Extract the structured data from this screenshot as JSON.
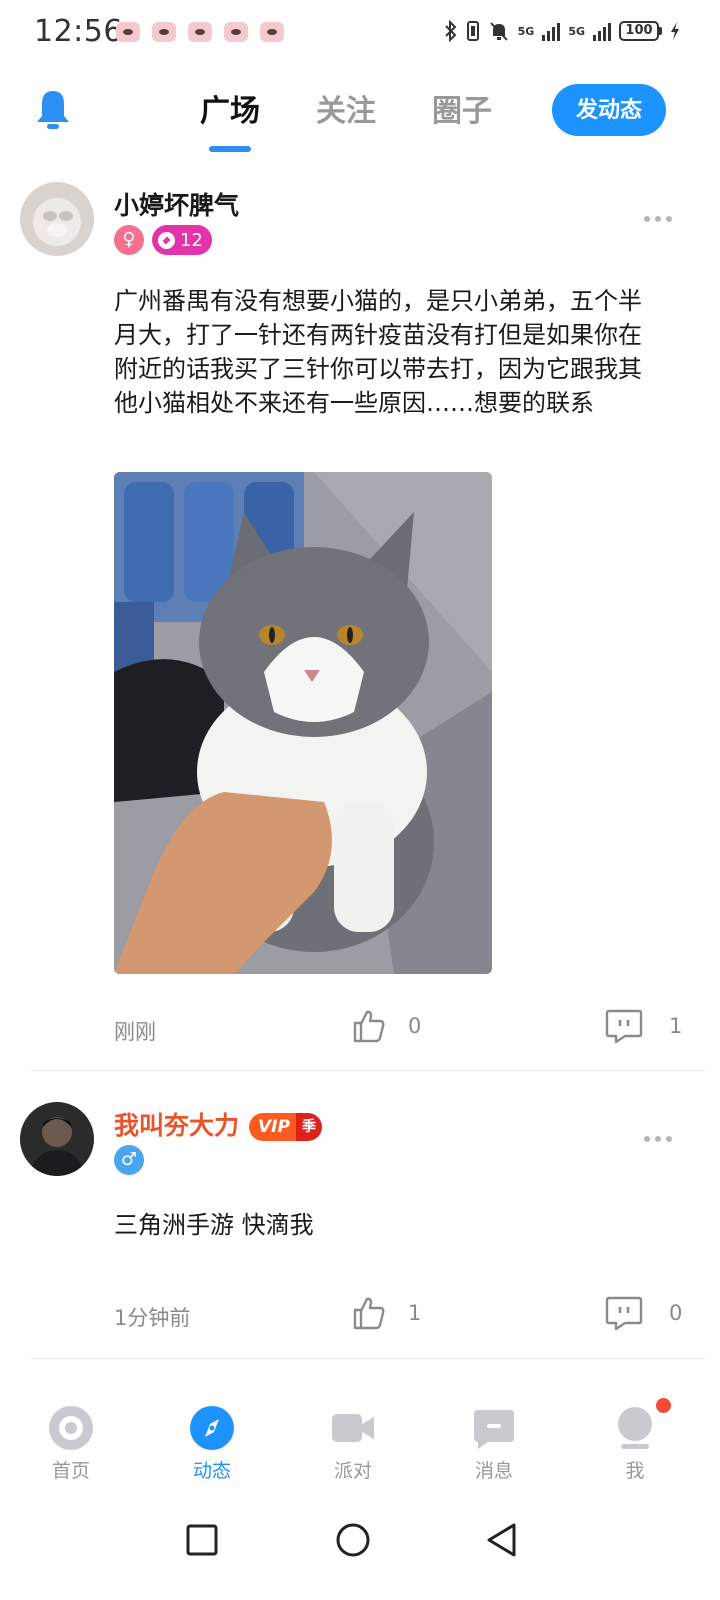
{
  "status_bar": {
    "time": "12:56",
    "network_1": "5G",
    "network_2": "5G",
    "battery": "100"
  },
  "top_nav": {
    "tabs": [
      {
        "label": "广场",
        "active": true
      },
      {
        "label": "关注",
        "active": false
      },
      {
        "label": "圈子",
        "active": false
      }
    ],
    "post_button": "发动态",
    "accent_color": "#1d93ff"
  },
  "posts": [
    {
      "username": "小婷坏脾气",
      "username_color": "#1a1a1a",
      "gender": "♀",
      "gender_color": "#f4708f",
      "level": "12",
      "text": "广州番禺有没有想要小猫的，是只小弟弟，五个半月大，打了一针还有两针疫苗没有打但是如果你在附近的话我买了三针你可以带去打，因为它跟我其他小猫相处不来还有一些原因……想要的联系",
      "image": "cat-photo",
      "time": "刚刚",
      "likes": "0",
      "comments": "1"
    },
    {
      "username": "我叫夯大力",
      "username_color": "#e8542b",
      "vip_label": "VIP",
      "vip_season": "季",
      "gender": "♂",
      "gender_color": "#4aa5f0",
      "text": "三角洲手游 快滴我",
      "time": "1分钟前",
      "likes": "1",
      "comments": "0"
    }
  ],
  "bottom_nav": [
    {
      "label": "首页",
      "icon": "home-icon",
      "active": false
    },
    {
      "label": "动态",
      "icon": "compass-icon",
      "active": true
    },
    {
      "label": "派对",
      "icon": "party-camera-icon",
      "active": false
    },
    {
      "label": "消息",
      "icon": "message-icon",
      "active": false
    },
    {
      "label": "我",
      "icon": "profile-icon",
      "active": false,
      "has_badge": true
    }
  ]
}
